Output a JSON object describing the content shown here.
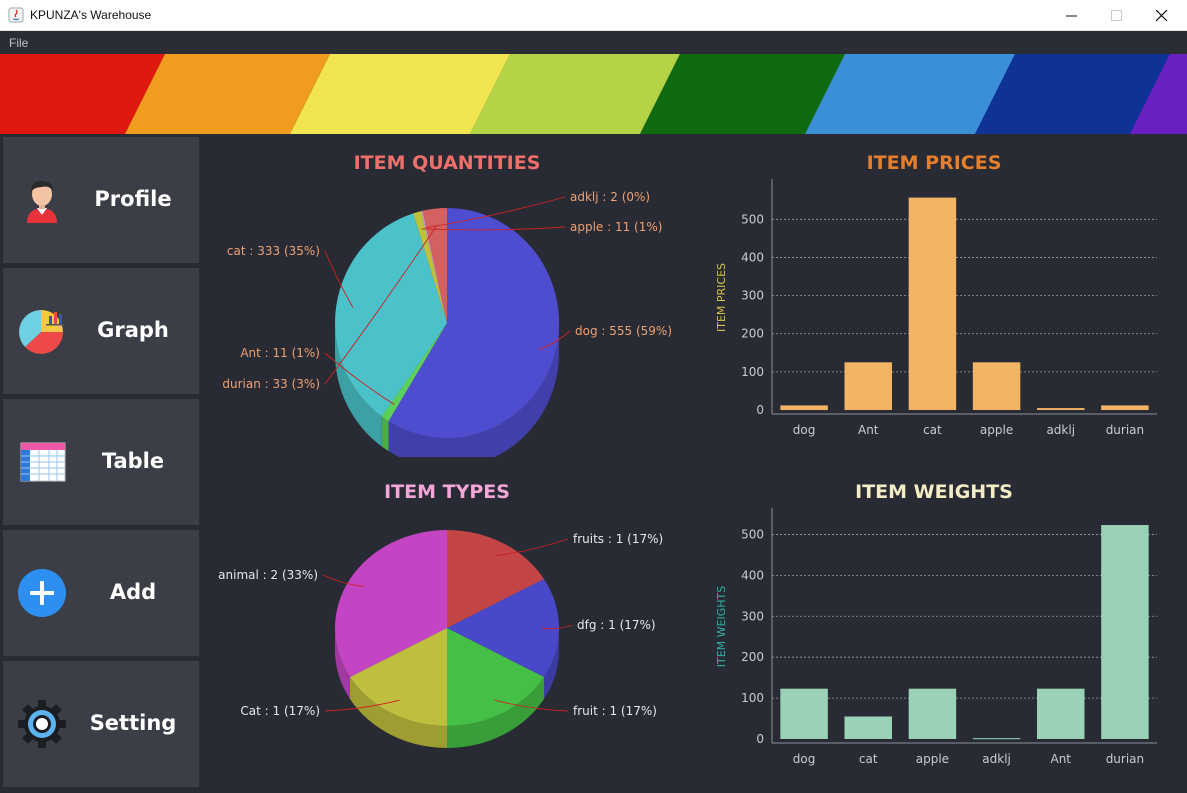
{
  "window": {
    "title": "KPUNZA's Warehouse"
  },
  "menu": {
    "file": "File"
  },
  "banner": {
    "colors": [
      "#e0190f",
      "#f29c1f",
      "#f2e552",
      "#b4d446",
      "#0f6a10",
      "#3b8fd6",
      "#0f3297",
      "#6a1fc0"
    ]
  },
  "sidebar": {
    "items": [
      {
        "label": "Profile",
        "icon": "user-icon"
      },
      {
        "label": "Graph",
        "icon": "pie-chart-icon"
      },
      {
        "label": "Table",
        "icon": "table-icon"
      },
      {
        "label": "Add",
        "icon": "plus-circle-icon"
      },
      {
        "label": "Setting",
        "icon": "gear-icon"
      }
    ]
  },
  "chart_data": [
    {
      "type": "pie",
      "title": "ITEM QUANTITIES",
      "title_color": "#ef6f6a",
      "slices": [
        {
          "label": "dog",
          "value": 555,
          "percent": 59,
          "text": "dog : 555 (59%)",
          "color": "#5350dc"
        },
        {
          "label": "Ant",
          "value": 11,
          "percent": 1,
          "text": "Ant : 11 (1%)",
          "color": "#5fe05e"
        },
        {
          "label": "cat",
          "value": 333,
          "percent": 35,
          "text": "cat : 333 (35%)",
          "color": "#4ecfd6"
        },
        {
          "label": "apple",
          "value": 11,
          "percent": 1,
          "text": "apple : 11 (1%)",
          "color": "#c9cf3c"
        },
        {
          "label": "adklj",
          "value": 2,
          "percent": 0,
          "text": "adklj : 2 (0%)",
          "color": "#e0a0e0"
        },
        {
          "label": "durian",
          "value": 33,
          "percent": 3,
          "text": "durian : 33 (3%)",
          "color": "#e26666"
        }
      ],
      "label_color": "#f0a070"
    },
    {
      "type": "bar",
      "title": "ITEM PRICES",
      "title_color": "#e57f2e",
      "ylabel": "ITEM PRICES",
      "ylabel_color": "#d8c24a",
      "bar_color": "#f4b466",
      "categories": [
        "dog",
        "Ant",
        "cat",
        "apple",
        "adklj",
        "durian"
      ],
      "values": [
        12,
        125,
        557,
        125,
        5,
        12
      ],
      "ylim": [
        0,
        590
      ],
      "yticks": [
        0,
        100,
        200,
        300,
        400,
        500
      ]
    },
    {
      "type": "pie",
      "title": "ITEM TYPES",
      "title_color": "#f4a6d8",
      "slices": [
        {
          "label": "fruits",
          "value": 1,
          "percent": 17,
          "text": "fruits : 1 (17%)",
          "color": "#d04848"
        },
        {
          "label": "dfg",
          "value": 1,
          "percent": 17,
          "text": "dfg : 1 (17%)",
          "color": "#4b4bd6"
        },
        {
          "label": "fruit",
          "value": 1,
          "percent": 17,
          "text": "fruit : 1 (17%)",
          "color": "#48cc48"
        },
        {
          "label": "Cat",
          "value": 1,
          "percent": 17,
          "text": "Cat : 1 (17%)",
          "color": "#cccc40"
        },
        {
          "label": "animal",
          "value": 2,
          "percent": 33,
          "text": "animal : 2 (33%)",
          "color": "#d048d0"
        }
      ],
      "label_color": "#e8e8e8"
    },
    {
      "type": "bar",
      "title": "ITEM WEIGHTS",
      "title_color": "#f4ecc4",
      "ylabel": "ITEM WEIGHTS",
      "ylabel_color": "#2fb3a6",
      "bar_color": "#9ad2b8",
      "categories": [
        "dog",
        "cat",
        "apple",
        "adklj",
        "Ant",
        "durian"
      ],
      "values": [
        123,
        55,
        123,
        2,
        123,
        523
      ],
      "ylim": [
        0,
        550
      ],
      "yticks": [
        0,
        100,
        200,
        300,
        400,
        500
      ]
    }
  ]
}
